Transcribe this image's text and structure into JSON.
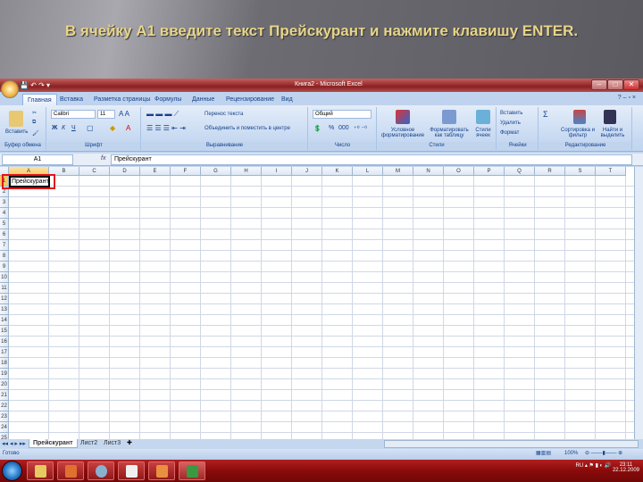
{
  "slide": {
    "title": "В ячейку А1 введите текст Прейскурант и нажмите клавишу ENTER."
  },
  "window": {
    "title": "Книга2 - Microsoft Excel",
    "controls": [
      "–",
      "□",
      "✕"
    ]
  },
  "tabs": [
    "Главная",
    "Вставка",
    "Разметка страницы",
    "Формулы",
    "Данные",
    "Рецензирование",
    "Вид"
  ],
  "active_tab": "Главная",
  "ribbon": {
    "clipboard": {
      "label": "Буфер обмена",
      "paste": "Вставить"
    },
    "font": {
      "label": "Шрифт",
      "name": "Calibri",
      "size": "11",
      "bold": "Ж",
      "italic": "К",
      "underline": "Ч"
    },
    "alignment": {
      "label": "Выравнивание",
      "wrap": "Перенос текста",
      "merge": "Объединить и поместить в центре"
    },
    "number": {
      "label": "Число",
      "format": "Общий",
      "percent": "%",
      "thousands": "000"
    },
    "styles": {
      "label": "Стили",
      "conditional": "Условное форматирование",
      "table": "Форматировать как таблицу",
      "cell": "Стили ячеек"
    },
    "cells": {
      "label": "Ячейки",
      "insert": "Вставить",
      "delete": "Удалить",
      "format": "Формат"
    },
    "editing": {
      "label": "Редактирование",
      "sum": "Σ",
      "sort": "Сортировка и фильтр",
      "find": "Найти и выделить"
    }
  },
  "formula_bar": {
    "name_box": "A1",
    "fx": "fx",
    "value": "Прейскурант"
  },
  "grid": {
    "columns": [
      "A",
      "B",
      "C",
      "D",
      "E",
      "F",
      "G",
      "H",
      "I",
      "J",
      "K",
      "L",
      "M",
      "N",
      "O",
      "P",
      "Q",
      "R",
      "S",
      "T"
    ],
    "rows": [
      "1",
      "2",
      "3",
      "4",
      "5",
      "6",
      "7",
      "8",
      "9",
      "10",
      "11",
      "12",
      "13",
      "14",
      "15",
      "16",
      "17",
      "18",
      "19",
      "20",
      "21",
      "22",
      "23",
      "24",
      "25"
    ],
    "active_cell": "A1",
    "a1_value": "Прейскурант",
    "highlight_color": "#e0161a"
  },
  "sheets": [
    "Прейскурант",
    "Лист2",
    "Лист3"
  ],
  "active_sheet": "Прейскурант",
  "status": {
    "mode": "Готово",
    "zoom": "100%"
  },
  "taskbar": {
    "time": "23:11",
    "date": "22.12.2009",
    "lang": "RU"
  }
}
